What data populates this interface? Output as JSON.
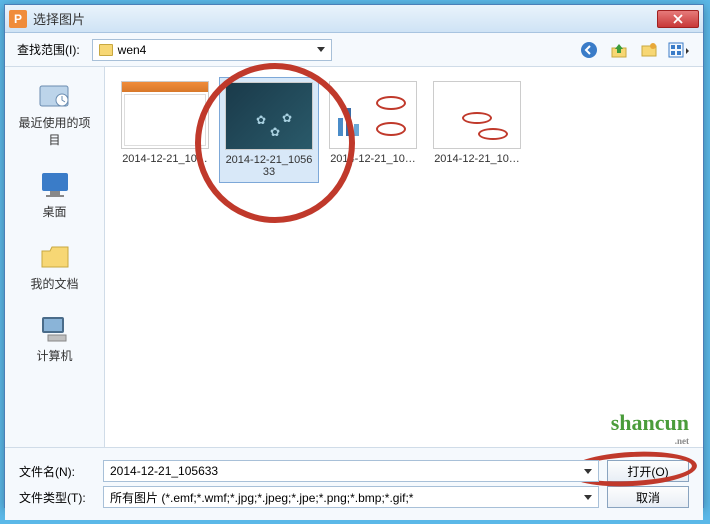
{
  "titlebar": {
    "icon_letter": "P",
    "title": "选择图片"
  },
  "toolbar": {
    "range_label": "查找范围(I):",
    "folder_name": "wen4",
    "nav": {
      "back": "back-icon",
      "up": "up-icon",
      "newfolder": "new-folder-icon",
      "view": "view-menu-icon"
    }
  },
  "sidebar": {
    "items": [
      {
        "label": "最近使用的项目"
      },
      {
        "label": "桌面"
      },
      {
        "label": "我的文档"
      },
      {
        "label": "计算机"
      }
    ]
  },
  "files": [
    {
      "label": "2014-12-21_10…",
      "selected": false,
      "kind": "ppt"
    },
    {
      "label": "2014-12-21_105633",
      "selected": true,
      "kind": "dark"
    },
    {
      "label": "2014-12-21_10…",
      "selected": false,
      "kind": "chart"
    },
    {
      "label": "2014-12-21_10…",
      "selected": false,
      "kind": "form"
    }
  ],
  "bottom": {
    "filename_label": "文件名(N):",
    "filename_value": "2014-12-21_105633",
    "filetype_label": "文件类型(T):",
    "filetype_value": "所有图片 (*.emf;*.wmf;*.jpg;*.jpeg;*.jpe;*.png;*.bmp;*.gif;*",
    "open_label": "打开(O)",
    "cancel_label": "取消"
  },
  "watermark": {
    "main": "shancun",
    "sub": ".net"
  }
}
